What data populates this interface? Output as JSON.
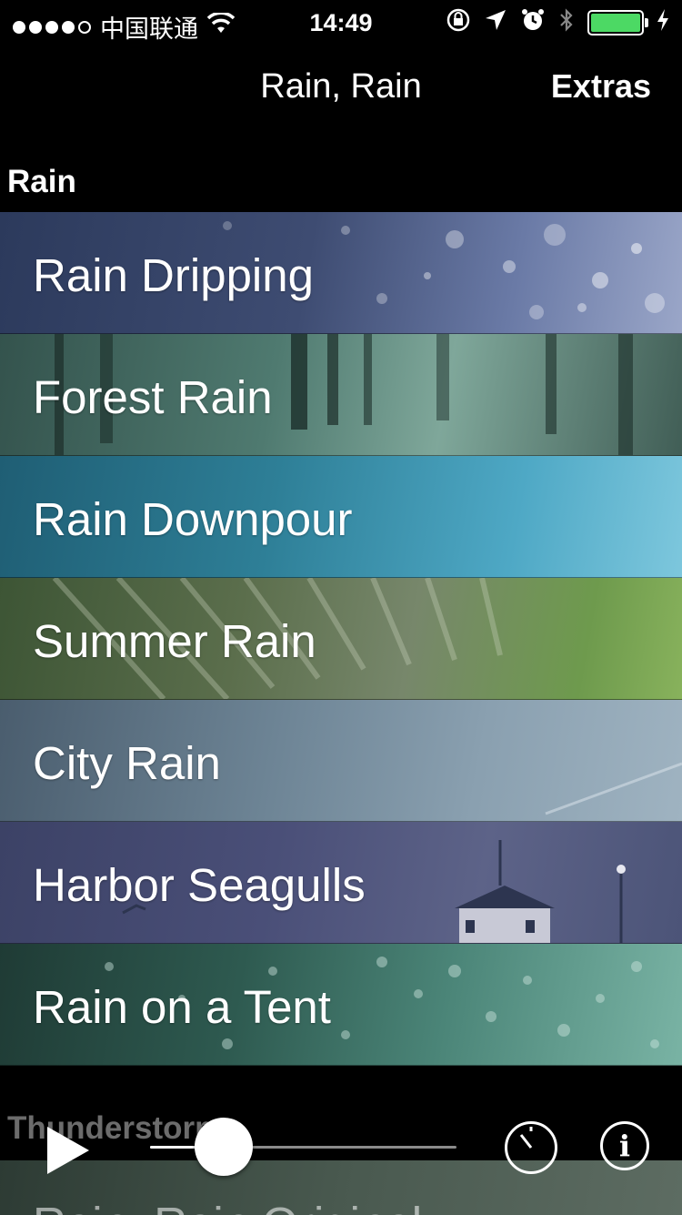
{
  "status_bar": {
    "carrier": "中国联通",
    "time": "14:49",
    "signal_strength": 4,
    "signal_max": 5,
    "battery_color": "#4cd964"
  },
  "nav": {
    "title": "Rain, Rain",
    "extras_label": "Extras"
  },
  "sections": [
    {
      "title": "Rain",
      "items": [
        {
          "label": "Rain Dripping"
        },
        {
          "label": "Forest Rain"
        },
        {
          "label": "Rain Downpour"
        },
        {
          "label": "Summer Rain"
        },
        {
          "label": "City Rain"
        },
        {
          "label": "Harbor Seagulls"
        },
        {
          "label": "Rain on a Tent"
        }
      ]
    },
    {
      "title": "Thunderstorms",
      "items": [
        {
          "label": "Rain, Rain Original"
        }
      ]
    }
  ],
  "player": {
    "play_icon": "play-icon",
    "timer_icon": "timer-icon",
    "info_icon": "info-icon",
    "info_glyph": "i",
    "progress": 0.24
  }
}
